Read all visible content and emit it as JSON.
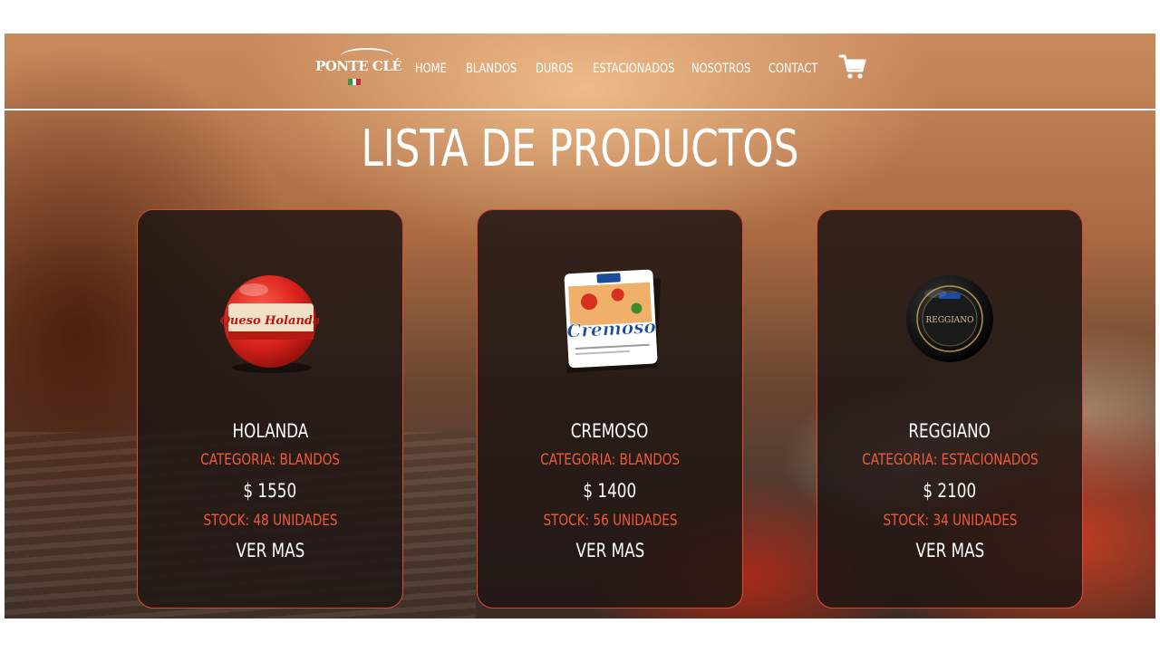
{
  "brand": {
    "logo_text": "PONTE CLÉ",
    "flag_colors": [
      "#2e9a3f",
      "#ffffff",
      "#d7262f"
    ]
  },
  "nav": {
    "items": [
      {
        "label": "HOME"
      },
      {
        "label": "BLANDOS"
      },
      {
        "label": "DUROS"
      },
      {
        "label": "ESTACIONADOS"
      },
      {
        "label": "NOSOTROS"
      },
      {
        "label": "CONTACT"
      }
    ],
    "cart_icon": "cart-icon"
  },
  "page": {
    "title": "LISTA DE PRODUCTOS"
  },
  "products": [
    {
      "name": "HOLANDA",
      "category": "CATEGORIA: BLANDOS",
      "price": "$ 1550",
      "stock": "STOCK: 48 UNIDADES",
      "more": "VER MAS",
      "image_icon": "red-wax-cheese-wheel",
      "label_text": "Queso Holanda"
    },
    {
      "name": "CREMOSO",
      "category": "CATEGORIA: BLANDOS",
      "price": "$ 1400",
      "stock": "STOCK: 56 UNIDADES",
      "more": "VER MAS",
      "image_icon": "cheese-package-box",
      "label_text": "Cremoso"
    },
    {
      "name": "REGGIANO",
      "category": "CATEGORIA: ESTACIONADOS",
      "price": "$ 2100",
      "stock": "STOCK: 34 UNIDADES",
      "more": "VER MAS",
      "image_icon": "black-cheese-wheel",
      "label_text": "REGGIANO"
    }
  ],
  "colors": {
    "accent": "#f05a36",
    "card_border": "#e04a35",
    "card_bg": "#201614"
  }
}
